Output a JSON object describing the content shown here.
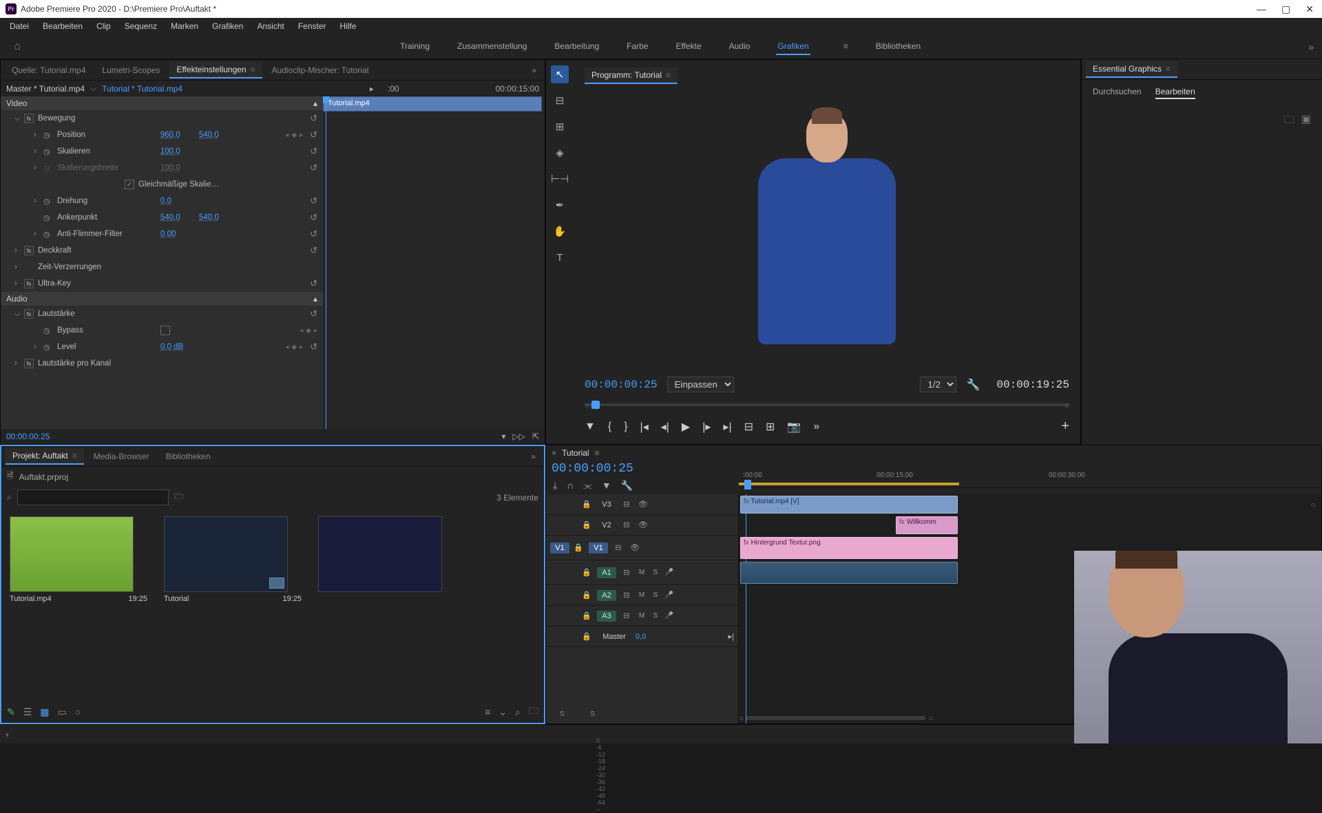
{
  "app": {
    "title": "Adobe Premiere Pro 2020 - D:\\Premiere Pro\\Auftakt *"
  },
  "menubar": [
    "Datei",
    "Bearbeiten",
    "Clip",
    "Sequenz",
    "Marken",
    "Grafiken",
    "Ansicht",
    "Fenster",
    "Hilfe"
  ],
  "workspaces": [
    "Training",
    "Zusammenstellung",
    "Bearbeitung",
    "Farbe",
    "Effekte",
    "Audio",
    "Grafiken",
    "Bibliotheken"
  ],
  "workspace_active": "Grafiken",
  "source_panel": {
    "tabs": [
      "Quelle: Tutorial.mp4",
      "Lumetri-Scopes",
      "Effekteinstellungen",
      "Audioclip-Mischer: Tutorial"
    ],
    "active_tab": "Effekteinstellungen",
    "master": "Master * Tutorial.mp4",
    "clip": "Tutorial * Tutorial.mp4",
    "head_time_start": ":00",
    "head_time_end": "00:00:15:00",
    "clip_bar": "Tutorial.mp4",
    "video_label": "Video",
    "bewegung": "Bewegung",
    "position": {
      "label": "Position",
      "x": "960,0",
      "y": "540,0"
    },
    "skalieren": {
      "label": "Skalieren",
      "v": "100,0"
    },
    "skalierungsbreite": {
      "label": "Skalierungsbreite",
      "v": "100,0"
    },
    "gleichmassige": "Gleichmäßige Skalie…",
    "drehung": {
      "label": "Drehung",
      "v": "0,0"
    },
    "ankerpunkt": {
      "label": "Ankerpunkt",
      "x": "540,0",
      "y": "540,0"
    },
    "antiflimmer": {
      "label": "Anti-Flimmer-Filter",
      "v": "0,00"
    },
    "deckkraft": "Deckkraft",
    "zeitverz": "Zeit-Verzerrungen",
    "ultrakey": "Ultra-Key",
    "audio_label": "Audio",
    "lautstarke": "Lautstärke",
    "bypass": "Bypass",
    "level": {
      "label": "Level",
      "v": "0,0 dB"
    },
    "lautkanal": "Lautstärke pro Kanal",
    "footer_tc": "00:00:00:25"
  },
  "project": {
    "tabs": [
      "Projekt: Auftakt",
      "Media-Browser",
      "Bibliotheken"
    ],
    "file": "Auftakt.prproj",
    "count": "3 Elemente",
    "items": [
      {
        "name": "Tutorial.mp4",
        "dur": "19:25"
      },
      {
        "name": "Tutorial",
        "dur": "19:25"
      }
    ]
  },
  "program": {
    "title": "Programm: Tutorial",
    "tc_in": "00:00:00:25",
    "tc_out": "00:00:19:25",
    "fit": "Einpassen",
    "res": "1/2"
  },
  "eg": {
    "title": "Essential Graphics",
    "tabs": [
      "Durchsuchen",
      "Bearbeiten"
    ],
    "active": "Bearbeiten"
  },
  "timeline": {
    "seq": "Tutorial",
    "tc": "00:00:00:25",
    "ruler": [
      ":00:00",
      "00:00:15:00",
      "00:00:30:00"
    ],
    "tracks_v": [
      "V3",
      "V2",
      "V1"
    ],
    "tracks_a": [
      "A1",
      "A2",
      "A3"
    ],
    "master": "Master",
    "master_val": "0,0",
    "clips": {
      "v3": "Tutorial.mp4 [V]",
      "v2": "Willkomm",
      "v1": "Hintergrund Textur.png"
    },
    "meter_scale": [
      "0",
      "-6",
      "-12",
      "-18",
      "-24",
      "-30",
      "-36",
      "-42",
      "-48",
      "-54",
      "--"
    ],
    "meter_s": "S"
  }
}
